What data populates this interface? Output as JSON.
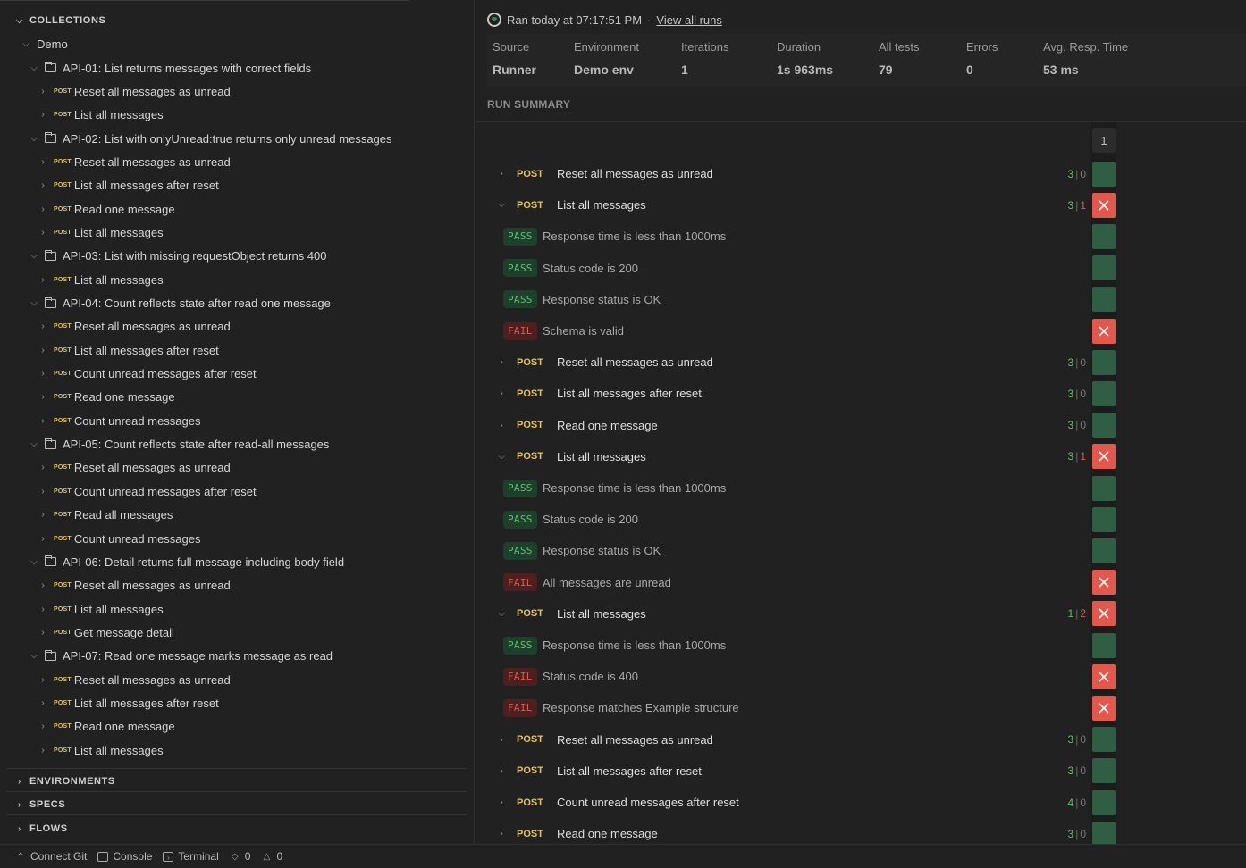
{
  "sidebar": {
    "collections_label": "COLLECTIONS",
    "root": "Demo",
    "tree": [
      {
        "kind": "folder",
        "label": "API-01: List returns messages with correct fields"
      },
      {
        "kind": "request",
        "method": "POST",
        "label": "Reset all messages as unread"
      },
      {
        "kind": "request",
        "method": "POST",
        "label": "List all messages"
      },
      {
        "kind": "folder",
        "label": "API-02: List with onlyUnread:true returns only unread messages"
      },
      {
        "kind": "request",
        "method": "POST",
        "label": "Reset all messages as unread"
      },
      {
        "kind": "request",
        "method": "POST",
        "label": "List all messages after reset"
      },
      {
        "kind": "request",
        "method": "POST",
        "label": "Read one message"
      },
      {
        "kind": "request",
        "method": "POST",
        "label": "List all messages"
      },
      {
        "kind": "folder",
        "label": "API-03: List with missing requestObject returns 400"
      },
      {
        "kind": "request",
        "method": "POST",
        "label": "List all messages"
      },
      {
        "kind": "folder",
        "label": "API-04: Count reflects state after read one message"
      },
      {
        "kind": "request",
        "method": "POST",
        "label": "Reset all messages as unread"
      },
      {
        "kind": "request",
        "method": "POST",
        "label": "List all messages after reset"
      },
      {
        "kind": "request",
        "method": "POST",
        "label": "Count unread messages after reset"
      },
      {
        "kind": "request",
        "method": "POST",
        "label": "Read one message"
      },
      {
        "kind": "request",
        "method": "POST",
        "label": "Count unread messages"
      },
      {
        "kind": "folder",
        "label": "API-05: Count reflects state after read-all messages"
      },
      {
        "kind": "request",
        "method": "POST",
        "label": "Reset all messages as unread"
      },
      {
        "kind": "request",
        "method": "POST",
        "label": "Count unread messages after reset"
      },
      {
        "kind": "request",
        "method": "POST",
        "label": "Read all messages"
      },
      {
        "kind": "request",
        "method": "POST",
        "label": "Count unread messages"
      },
      {
        "kind": "folder",
        "label": "API-06: Detail returns full message including body field"
      },
      {
        "kind": "request",
        "method": "POST",
        "label": "Reset all messages as unread"
      },
      {
        "kind": "request",
        "method": "POST",
        "label": "List all messages"
      },
      {
        "kind": "request",
        "method": "POST",
        "label": "Get message detail"
      },
      {
        "kind": "folder",
        "label": "API-07: Read one message marks message as read"
      },
      {
        "kind": "request",
        "method": "POST",
        "label": "Reset all messages as unread"
      },
      {
        "kind": "request",
        "method": "POST",
        "label": "List all messages after reset"
      },
      {
        "kind": "request",
        "method": "POST",
        "label": "Read one message"
      },
      {
        "kind": "request",
        "method": "POST",
        "label": "List all messages"
      }
    ],
    "sections": [
      "ENVIRONMENTS",
      "SPECS",
      "FLOWS"
    ]
  },
  "statusbar": {
    "connect_git": "Connect Git",
    "console": "Console",
    "terminal": "Terminal",
    "errors_count": "0",
    "warnings_count": "0"
  },
  "run": {
    "ran_text": "Ran today at 07:17:51 PM",
    "separator": "·",
    "view_all_runs": "View all runs"
  },
  "stats": [
    {
      "label": "Source",
      "value": "Runner"
    },
    {
      "label": "Environment",
      "value": "Demo env"
    },
    {
      "label": "Iterations",
      "value": "1"
    },
    {
      "label": "Duration",
      "value": "1s 963ms"
    },
    {
      "label": "All tests",
      "value": "79"
    },
    {
      "label": "Errors",
      "value": "0"
    },
    {
      "label": "Avg. Resp. Time",
      "value": "53 ms"
    }
  ],
  "summary_label": "RUN SUMMARY",
  "iteration_header": "1",
  "results": [
    {
      "type": "request",
      "expanded": false,
      "method": "POST",
      "name": "Reset all messages as unread",
      "pass": "3",
      "fail": "0",
      "status": "ok"
    },
    {
      "type": "request",
      "expanded": true,
      "method": "POST",
      "name": "List all messages",
      "pass": "3",
      "fail": "1",
      "status": "bad"
    },
    {
      "type": "test",
      "result": "PASS",
      "name": "Response time is less than 1000ms",
      "status": "ok"
    },
    {
      "type": "test",
      "result": "PASS",
      "name": "Status code is 200",
      "status": "ok"
    },
    {
      "type": "test",
      "result": "PASS",
      "name": "Response status is OK",
      "status": "ok"
    },
    {
      "type": "test",
      "result": "FAIL",
      "name": "Schema is valid",
      "status": "bad"
    },
    {
      "type": "request",
      "expanded": false,
      "method": "POST",
      "name": "Reset all messages as unread",
      "pass": "3",
      "fail": "0",
      "status": "ok"
    },
    {
      "type": "request",
      "expanded": false,
      "method": "POST",
      "name": "List all messages after reset",
      "pass": "3",
      "fail": "0",
      "status": "ok"
    },
    {
      "type": "request",
      "expanded": false,
      "method": "POST",
      "name": "Read one message",
      "pass": "3",
      "fail": "0",
      "status": "ok"
    },
    {
      "type": "request",
      "expanded": true,
      "method": "POST",
      "name": "List all messages",
      "pass": "3",
      "fail": "1",
      "status": "bad"
    },
    {
      "type": "test",
      "result": "PASS",
      "name": "Response time is less than 1000ms",
      "status": "ok"
    },
    {
      "type": "test",
      "result": "PASS",
      "name": "Status code is 200",
      "status": "ok"
    },
    {
      "type": "test",
      "result": "PASS",
      "name": "Response status is OK",
      "status": "ok"
    },
    {
      "type": "test",
      "result": "FAIL",
      "name": "All messages are unread",
      "status": "bad"
    },
    {
      "type": "request",
      "expanded": true,
      "method": "POST",
      "name": "List all messages",
      "pass": "1",
      "fail": "2",
      "status": "bad"
    },
    {
      "type": "test",
      "result": "PASS",
      "name": "Response time is less than 1000ms",
      "status": "ok"
    },
    {
      "type": "test",
      "result": "FAIL",
      "name": "Status code is 400",
      "status": "bad"
    },
    {
      "type": "test",
      "result": "FAIL",
      "name": "Response matches Example structure",
      "status": "bad"
    },
    {
      "type": "request",
      "expanded": false,
      "method": "POST",
      "name": "Reset all messages as unread",
      "pass": "3",
      "fail": "0",
      "status": "ok"
    },
    {
      "type": "request",
      "expanded": false,
      "method": "POST",
      "name": "List all messages after reset",
      "pass": "3",
      "fail": "0",
      "status": "ok"
    },
    {
      "type": "request",
      "expanded": false,
      "method": "POST",
      "name": "Count unread messages after reset",
      "pass": "4",
      "fail": "0",
      "status": "ok"
    },
    {
      "type": "request",
      "expanded": false,
      "method": "POST",
      "name": "Read one message",
      "pass": "3",
      "fail": "0",
      "status": "ok"
    }
  ],
  "colors": {
    "pass": "#5ec26a",
    "fail": "#e4584c",
    "method_post": "#e2c159",
    "cell_ok": "#2f5e44"
  }
}
